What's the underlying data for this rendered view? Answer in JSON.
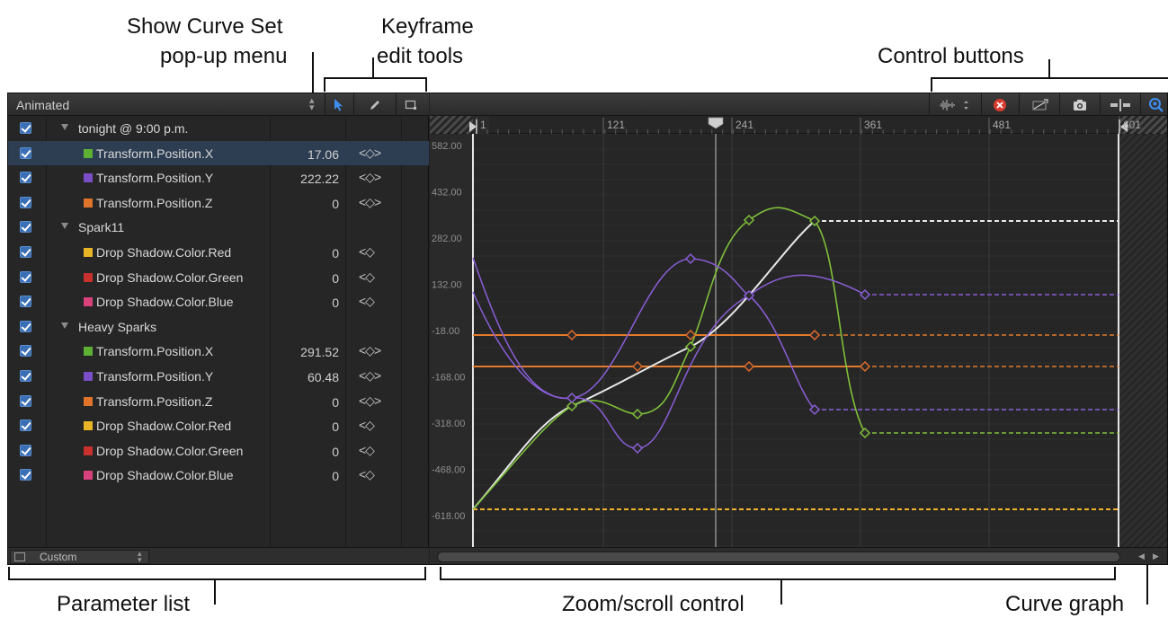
{
  "callouts": {
    "show_curve_set": [
      "Show Curve Set",
      "pop-up menu"
    ],
    "keyframe_tools": [
      "Keyframe",
      "edit tools"
    ],
    "control_buttons": "Control buttons",
    "parameter_list": "Parameter list",
    "zoom_scroll": "Zoom/scroll control",
    "curve_graph": "Curve graph"
  },
  "left_panel": {
    "curve_set": "Animated",
    "layout_menu": "Custom",
    "tools": [
      "arrow-icon",
      "pencil-icon",
      "box-icon"
    ],
    "rows": [
      {
        "type": "group",
        "checked": true,
        "name": "tonight @ 9:00 p.m."
      },
      {
        "type": "param",
        "checked": true,
        "name": "Transform.Position.X",
        "value": "17.06",
        "color": "#5cb034",
        "nav": "<◇>",
        "selected": true
      },
      {
        "type": "param",
        "checked": true,
        "name": "Transform.Position.Y",
        "value": "222.22",
        "color": "#7a4ec7",
        "nav": "<◇>"
      },
      {
        "type": "param",
        "checked": true,
        "name": "Transform.Position.Z",
        "value": "0",
        "color": "#e0742a",
        "nav": "<◇>"
      },
      {
        "type": "group",
        "checked": true,
        "name": "Spark11"
      },
      {
        "type": "param",
        "checked": true,
        "name": "Drop Shadow.Color.Red",
        "value": "0",
        "color": "#e8b526",
        "nav": "<◇"
      },
      {
        "type": "param",
        "checked": true,
        "name": "Drop Shadow.Color.Green",
        "value": "0",
        "color": "#c8312e",
        "nav": "<◇"
      },
      {
        "type": "param",
        "checked": true,
        "name": "Drop Shadow.Color.Blue",
        "value": "0",
        "color": "#d9417d",
        "nav": "<◇"
      },
      {
        "type": "group",
        "checked": true,
        "name": "Heavy Sparks"
      },
      {
        "type": "param",
        "checked": true,
        "name": "Transform.Position.X",
        "value": "291.52",
        "color": "#5cb034",
        "nav": "<◇>"
      },
      {
        "type": "param",
        "checked": true,
        "name": "Transform.Position.Y",
        "value": "60.48",
        "color": "#7a4ec7",
        "nav": "<◇>"
      },
      {
        "type": "param",
        "checked": true,
        "name": "Transform.Position.Z",
        "value": "0",
        "color": "#e0742a",
        "nav": "<◇>"
      },
      {
        "type": "param",
        "checked": true,
        "name": "Drop Shadow.Color.Red",
        "value": "0",
        "color": "#e8b526",
        "nav": "<◇"
      },
      {
        "type": "param",
        "checked": true,
        "name": "Drop Shadow.Color.Green",
        "value": "0",
        "color": "#c8312e",
        "nav": "<◇"
      },
      {
        "type": "param",
        "checked": true,
        "name": "Drop Shadow.Color.Blue",
        "value": "0",
        "color": "#d9417d",
        "nav": "<◇"
      }
    ]
  },
  "control_buttons": [
    "audio-waveform-icon",
    "clear-curves-icon",
    "fit-curve-icon",
    "snapshot-icon",
    "snapping-icon",
    "zoom-icon"
  ],
  "timeline": {
    "ticks": [
      "1",
      "121",
      "241",
      "361",
      "481",
      "601"
    ],
    "playhead_frame": 191
  },
  "graph": {
    "y_labels": [
      "582.00",
      "432.00",
      "282.00",
      "132.00",
      "-18.00",
      "-168.00",
      "-318.00",
      "-468.00",
      "-618.00"
    ],
    "colors": {
      "green": "#7fbf3a",
      "purple": "#8a5ed6",
      "orange": "#e27a2c",
      "white": "#e8e8e8",
      "yellow": "#f2b12b",
      "keyframe_orange": "#e06a2a"
    }
  }
}
